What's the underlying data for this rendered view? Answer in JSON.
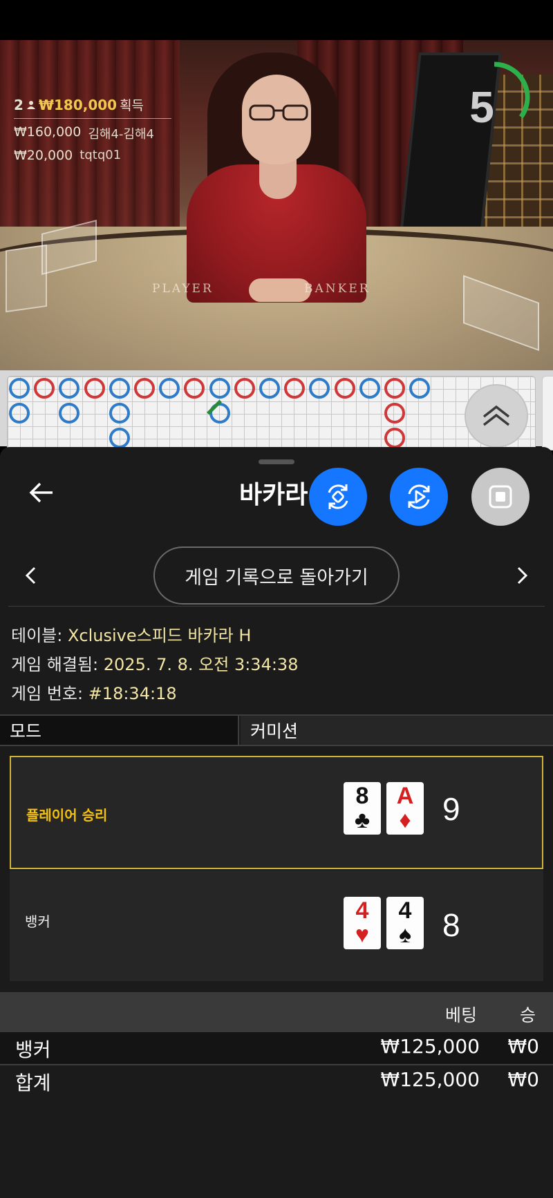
{
  "video": {
    "winners": {
      "count": "2",
      "total": "₩180,000",
      "suffix": "획득",
      "rows": [
        {
          "amount": "₩160,000",
          "name": "김해4-김해4"
        },
        {
          "amount": "₩20,000",
          "name": "tqtq01"
        }
      ]
    },
    "timer": {
      "value": "5",
      "progress_fraction": 0.35,
      "color": "#2db04b"
    },
    "table_labels": {
      "player": "PLAYER",
      "banker": "BANKER"
    }
  },
  "roadmap": {
    "colors": {
      "player": "#2f7bc7",
      "banker": "#cf3838"
    }
  },
  "sheet": {
    "title": "바카라",
    "history_button": "게임 기록으로 돌아가기",
    "info": {
      "table_label": "테이블:",
      "table_value": "Xclusive스피드 바카라 H",
      "resolved_label": "게임 해결됨:",
      "resolved_value": "2025. 7. 8. 오전 3:34:38",
      "number_label": "게임 번호:",
      "number_value": "#18:34:18"
    },
    "mode": {
      "label": "모드",
      "value": "커미션"
    },
    "player_hand": {
      "label": "플레이어 승리",
      "cards": [
        {
          "rank": "8",
          "suit": "♣"
        },
        {
          "rank": "A",
          "suit": "♦"
        }
      ],
      "score": "9"
    },
    "banker_hand": {
      "label": "뱅커",
      "cards": [
        {
          "rank": "4",
          "suit": "♥"
        },
        {
          "rank": "4",
          "suit": "♠"
        }
      ],
      "score": "8"
    },
    "bets": {
      "headers": {
        "bet": "베팅",
        "win": "승"
      },
      "rows": [
        {
          "name": "뱅커",
          "bet": "₩125,000",
          "win": "₩0"
        },
        {
          "name": "합계",
          "bet": "₩125,000",
          "win": "₩0"
        }
      ]
    }
  },
  "colors": {
    "accent_blue": "#1577ff",
    "win_gold": "#f4c20d",
    "info_value": "#f3e6a4"
  }
}
